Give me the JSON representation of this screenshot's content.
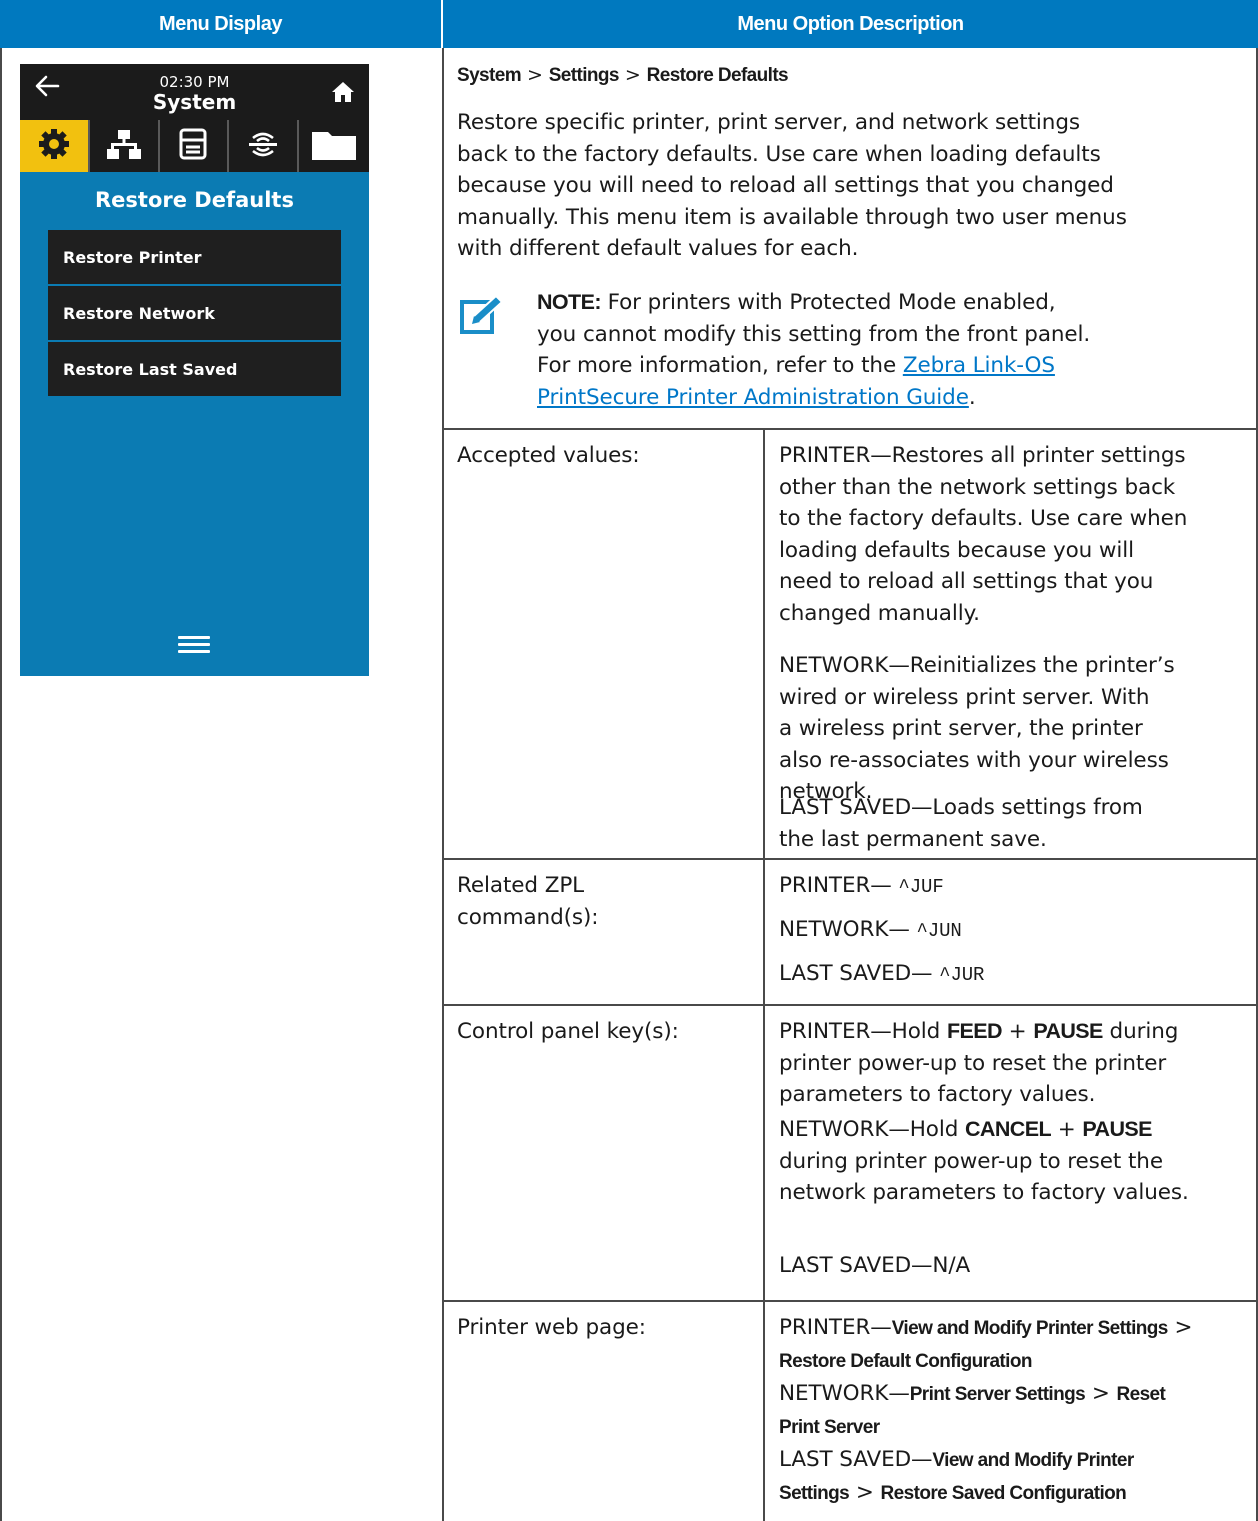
{
  "header": {
    "menu_display": "Menu Display",
    "menu_option_description": "Menu Option Description"
  },
  "phone": {
    "time": "02:30 PM",
    "title": "System",
    "section_title": "Restore Defaults",
    "items": [
      "Restore Printer",
      "Restore Network",
      "Restore Last Saved"
    ],
    "tabs": [
      "gear-icon",
      "network-icon",
      "printer-icon",
      "wireless-icon",
      "folder-icon"
    ],
    "accent_color": "#f2c10f",
    "screen_color": "#0b7bb3"
  },
  "desc": {
    "breadcrumb": [
      "System",
      ">",
      "Settings",
      ">",
      "Restore Defaults"
    ],
    "para": [
      "Restore specific printer, print server, and network settings",
      "back to the factory defaults. Use care when loading defaults",
      "because you will need to reload all settings that you changed",
      "manually. This menu item is available through two user menus",
      "with different default values for each."
    ],
    "note_label": "NOTE:",
    "note_l1": "For printers with Protected Mode enabled,",
    "note_l2": "you cannot modify this setting from the front panel.",
    "note_l3": "For more information, refer to the",
    "note_link1": "Zebra Link-OS",
    "note_link2": "PrintSecure Printer Administration Guide",
    "note_end": "."
  },
  "rows": {
    "accepted": {
      "label": "Accepted values:",
      "printer": [
        "PRINTER—Restores all printer settings",
        "other than the network settings back",
        "to the factory defaults. Use care when",
        "loading defaults because you will",
        "need to reload all settings that you",
        "changed manually."
      ],
      "network": [
        "NETWORK—Reinitializes the printer’s",
        "wired or wireless print server. With",
        "a wireless print server, the printer",
        "also re-associates with your wireless",
        "network."
      ],
      "last": [
        "LAST SAVED—Loads settings from",
        "the last permanent save."
      ]
    },
    "zpl": {
      "label1": "Related ZPL",
      "label2": "command(s):",
      "printer_prefix": "PRINTER— ",
      "printer_cmd": "^JUF",
      "network_prefix": "NETWORK— ",
      "network_cmd": "^JUN",
      "last_prefix": "LAST SAVED— ",
      "last_cmd": "^JUR"
    },
    "keys": {
      "label": "Control panel key(s):",
      "p1_a": "PRINTER—Hold ",
      "p1_feed": "FEED",
      "p1_plus": " + ",
      "p1_pause": "PAUSE",
      "p1_b": " during",
      "p2": "printer power-up to reset the printer",
      "p3": "parameters to factory values.",
      "n1_a": "NETWORK—Hold ",
      "n1_cancel": "CANCEL",
      "n1_plus": " + ",
      "n1_pause": "PAUSE",
      "n2": "during printer power-up to reset the",
      "n3": "network parameters to factory values.",
      "last": "LAST SAVED—N/A"
    },
    "web": {
      "label": "Printer web page:",
      "p_prefix": "PRINTER—",
      "p_b1": "View and Modify Printer Settings",
      "p_sep": " > ",
      "p_b2": "Restore Default Configuration",
      "n_prefix": "NETWORK—",
      "n_b1": "Print Server Settings",
      "n_sep": " > ",
      "n_b2a": "Reset",
      "n_b2b": "Print Server",
      "l_prefix": "LAST SAVED—",
      "l_b1": "View and Modify Printer",
      "l_b2": "Settings",
      "l_sep": " > ",
      "l_b3": "Restore Saved Configuration"
    }
  }
}
